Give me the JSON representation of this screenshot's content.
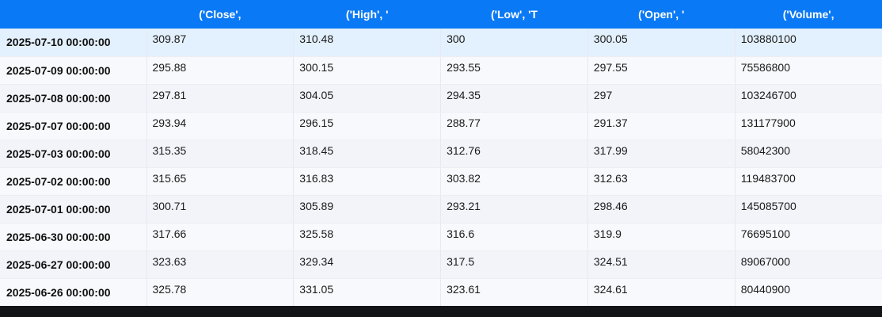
{
  "table": {
    "headers": [
      "",
      "('Close',",
      "('High', '",
      "('Low', 'T",
      "('Open', '",
      "('Volume',"
    ],
    "rows": [
      {
        "index": "2025-07-10 00:00:00",
        "values": [
          "309.87",
          "310.48",
          "300",
          "300.05",
          "103880100"
        ]
      },
      {
        "index": "2025-07-09 00:00:00",
        "values": [
          "295.88",
          "300.15",
          "293.55",
          "297.55",
          "75586800"
        ]
      },
      {
        "index": "2025-07-08 00:00:00",
        "values": [
          "297.81",
          "304.05",
          "294.35",
          "297",
          "103246700"
        ]
      },
      {
        "index": "2025-07-07 00:00:00",
        "values": [
          "293.94",
          "296.15",
          "288.77",
          "291.37",
          "131177900"
        ]
      },
      {
        "index": "2025-07-03 00:00:00",
        "values": [
          "315.35",
          "318.45",
          "312.76",
          "317.99",
          "58042300"
        ]
      },
      {
        "index": "2025-07-02 00:00:00",
        "values": [
          "315.65",
          "316.83",
          "303.82",
          "312.63",
          "119483700"
        ]
      },
      {
        "index": "2025-07-01 00:00:00",
        "values": [
          "300.71",
          "305.89",
          "293.21",
          "298.46",
          "145085700"
        ]
      },
      {
        "index": "2025-06-30 00:00:00",
        "values": [
          "317.66",
          "325.58",
          "316.6",
          "319.9",
          "76695100"
        ]
      },
      {
        "index": "2025-06-27 00:00:00",
        "values": [
          "323.63",
          "329.34",
          "317.5",
          "324.51",
          "89067000"
        ]
      },
      {
        "index": "2025-06-26 00:00:00",
        "values": [
          "325.78",
          "331.05",
          "323.61",
          "324.61",
          "80440900"
        ]
      }
    ]
  },
  "colors": {
    "header_bg": "#0a79f5",
    "header_text": "#ffffff",
    "highlight_row": "#e3f0fd",
    "bottom_bar": "#121316"
  }
}
